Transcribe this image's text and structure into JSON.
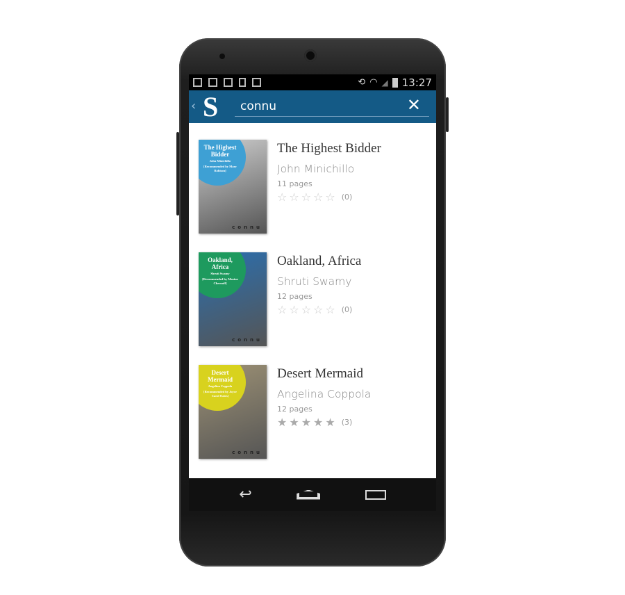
{
  "status_bar": {
    "time": "13:27",
    "icons_left": [
      "image-icon",
      "barcode-icon",
      "gmail-icon",
      "download-icon",
      "bag-check-icon"
    ],
    "icons_right": [
      "rotate-icon",
      "wifi-icon",
      "signal-icon",
      "battery-icon"
    ]
  },
  "app_bar": {
    "logo": "S",
    "search_value": "connu",
    "brand_color": "#145a86"
  },
  "books": [
    {
      "title": "The Highest Bidder",
      "author": "John Minichillo",
      "pages": "11 pages",
      "rating_count": "(0)",
      "stars_filled": 0,
      "cover": {
        "title": "The Highest Bidder",
        "author": "John Minichillo",
        "rec": "[Recommended by Mary Robison]",
        "brand": "connu",
        "circle_color": "#3ea0d4",
        "bg": "#cfcfcf"
      }
    },
    {
      "title": "Oakland, Africa",
      "author": "Shruti Swamy",
      "pages": "12 pages",
      "rating_count": "(0)",
      "stars_filled": 0,
      "cover": {
        "title": "Oakland, Africa",
        "author": "Shruti Swamy",
        "rec": "[Recommended by Maxine Chernoff]",
        "brand": "connu",
        "circle_color": "#1e9a5e",
        "bg": "#2a6fb0"
      }
    },
    {
      "title": "Desert Mermaid",
      "author": "Angelina Coppola",
      "pages": "12 pages",
      "rating_count": "(3)",
      "stars_filled": 5,
      "cover": {
        "title": "Desert Mermaid",
        "author": "Angelina Coppola",
        "rec": "[Recommended by Joyce Carol Oates]",
        "brand": "connu",
        "circle_color": "#d8d21e",
        "bg": "#9e9275"
      }
    }
  ],
  "nav_bar": {
    "buttons": [
      "back",
      "home",
      "recents"
    ]
  }
}
